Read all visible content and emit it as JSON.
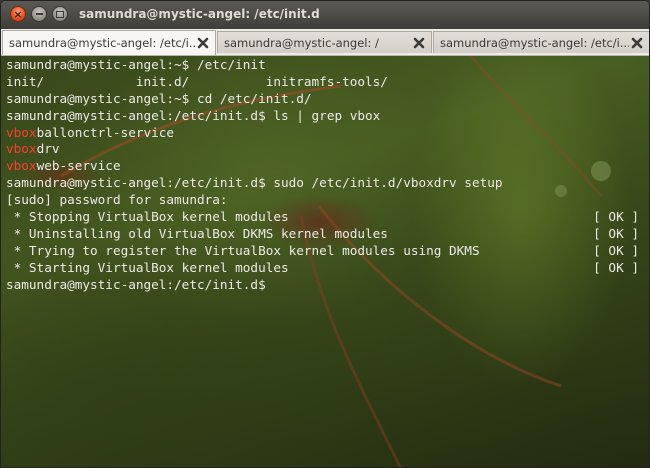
{
  "window": {
    "title": "samundra@mystic-angel: /etc/init.d",
    "close_icon": "close-icon",
    "minimize_icon": "minimize-icon",
    "maximize_icon": "maximize-icon"
  },
  "tabs": [
    {
      "label": "samundra@mystic-angel: /etc/i...",
      "active": true
    },
    {
      "label": "samundra@mystic-angel: /",
      "active": false
    },
    {
      "label": "samundra@mystic-angel: /etc/i...",
      "active": false
    }
  ],
  "terminal": {
    "colors": {
      "text": "#eceae6",
      "highlight": "#ff3b2f"
    },
    "lines": [
      {
        "text": "samundra@mystic-angel:~$ /etc/init"
      },
      {
        "text": "init/            init.d/          initramfs-tools/"
      },
      {
        "text": "samundra@mystic-angel:~$ cd /etc/init.d/"
      },
      {
        "text": "samundra@mystic-angel:/etc/init.d$ ls | grep vbox"
      },
      {
        "highlight": "vbox",
        "rest": "ballonctrl-service"
      },
      {
        "highlight": "vbox",
        "rest": "drv"
      },
      {
        "highlight": "vbox",
        "rest": "web-service"
      },
      {
        "text": "samundra@mystic-angel:/etc/init.d$ sudo /etc/init.d/vboxdrv setup"
      },
      {
        "text": "[sudo] password for samundra:"
      },
      {
        "text": " * Stopping VirtualBox kernel modules",
        "status": "[ OK ]"
      },
      {
        "text": " * Uninstalling old VirtualBox DKMS kernel modules",
        "status": "[ OK ]"
      },
      {
        "text": " * Trying to register the VirtualBox kernel modules using DKMS",
        "status": "[ OK ]"
      },
      {
        "text": " * Starting VirtualBox kernel modules",
        "status": "[ OK ]"
      },
      {
        "text": "samundra@mystic-angel:/etc/init.d$"
      }
    ]
  }
}
